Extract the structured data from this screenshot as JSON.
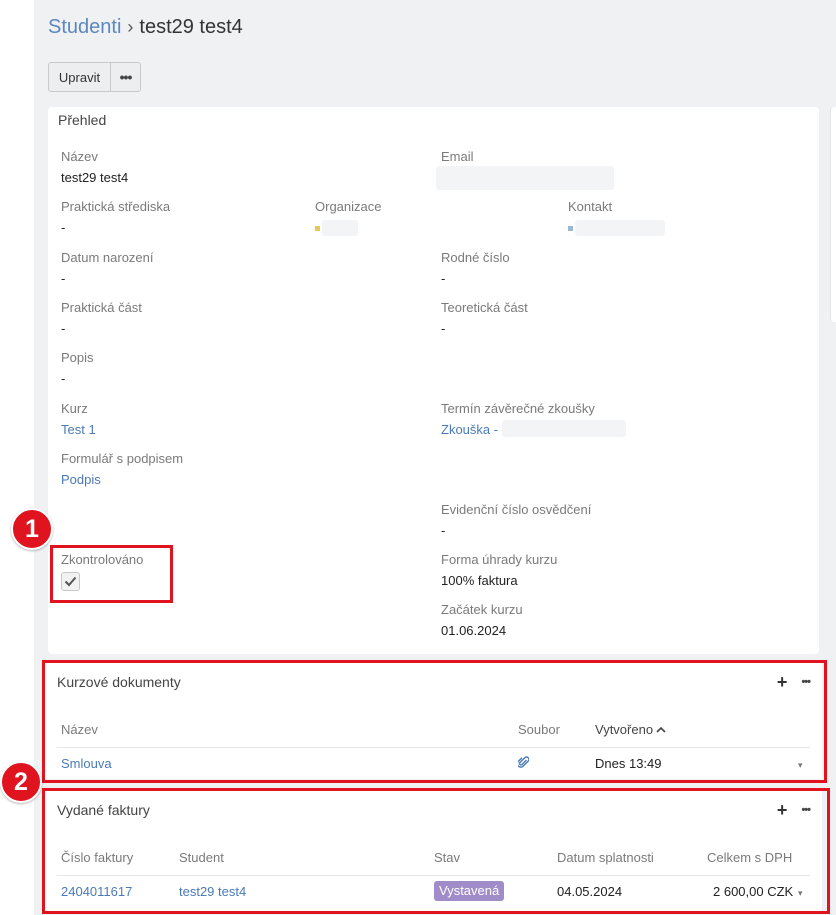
{
  "breadcrumb": {
    "parent": "Studenti",
    "separator": "›",
    "current": "test29 test4"
  },
  "toolbar": {
    "edit_label": "Upravit",
    "more_label": "•••"
  },
  "overview": {
    "title": "Přehled",
    "fields": {
      "nazev": {
        "label": "Název",
        "value": "test29 test4"
      },
      "email": {
        "label": "Email"
      },
      "prakticka_strediska": {
        "label": "Praktická střediska",
        "value": "-"
      },
      "organizace": {
        "label": "Organizace"
      },
      "kontakt": {
        "label": "Kontakt"
      },
      "datum_narozeni": {
        "label": "Datum narození",
        "value": "-"
      },
      "rodne_cislo": {
        "label": "Rodné číslo",
        "value": "-"
      },
      "prakticka_cast": {
        "label": "Praktická část",
        "value": "-"
      },
      "teoreticka_cast": {
        "label": "Teoretická část",
        "value": "-"
      },
      "popis": {
        "label": "Popis",
        "value": "-"
      },
      "kurz": {
        "label": "Kurz",
        "value": "Test 1"
      },
      "termin": {
        "label": "Termín závěrečné zkoušky",
        "value": "Zkouška -"
      },
      "formular": {
        "label": "Formulář s podpisem",
        "value": "Podpis"
      },
      "evidencni": {
        "label": "Evidenční číslo osvědčení",
        "value": "-"
      },
      "zkontrolovano": {
        "label": "Zkontrolováno",
        "checked": true
      },
      "forma_uhrady": {
        "label": "Forma úhrady kurzu",
        "value": "100% faktura"
      },
      "zacatek": {
        "label": "Začátek kurzu",
        "value": "01.06.2024"
      }
    }
  },
  "annotations": {
    "badge1": "1",
    "badge2": "2"
  },
  "documents": {
    "title": "Kurzové dokumenty",
    "columns": {
      "name": "Název",
      "file": "Soubor",
      "created": "Vytvořeno"
    },
    "rows": [
      {
        "name": "Smlouva",
        "created": "Dnes 13:49"
      }
    ]
  },
  "invoices": {
    "title": "Vydané faktury",
    "columns": {
      "number": "Číslo faktury",
      "student": "Student",
      "status": "Stav",
      "due": "Datum splatnosti",
      "total": "Celkem s DPH"
    },
    "rows": [
      {
        "number": "2404011617",
        "student": "test29 test4",
        "status": "Vystavená",
        "due": "04.05.2024",
        "total": "2 600,00 CZK"
      }
    ]
  },
  "colors": {
    "accent": "#4a7ab8",
    "highlight": "#e0141e",
    "status_issued": "#a08cc8"
  }
}
